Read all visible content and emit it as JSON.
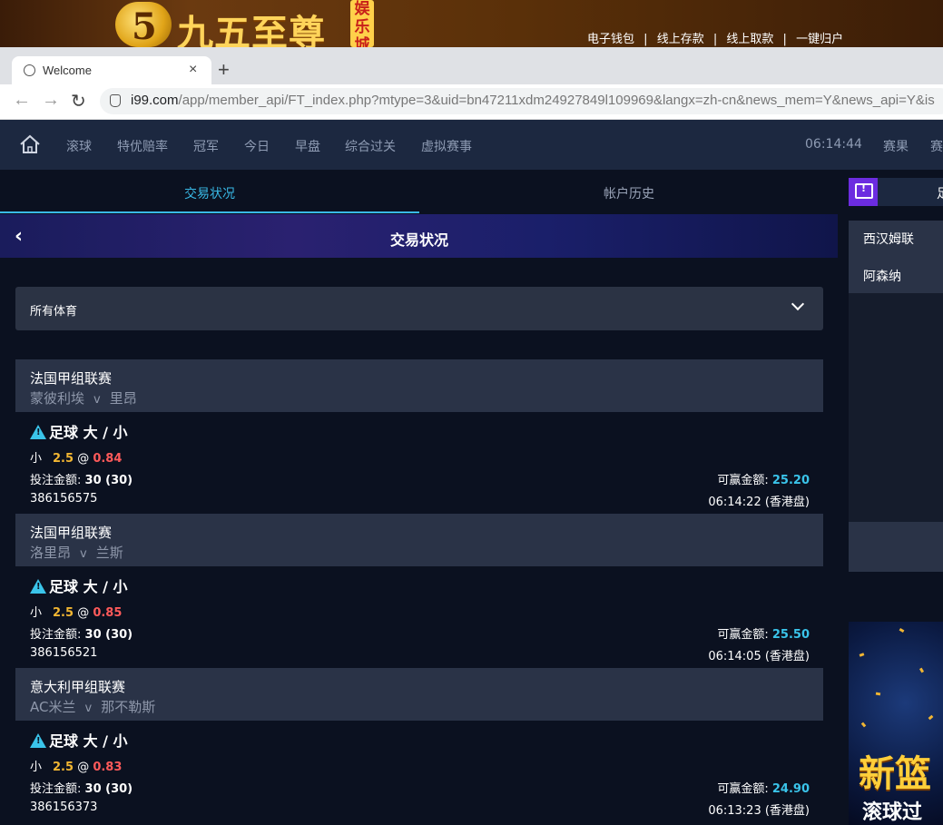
{
  "banner": {
    "logo_number": "5",
    "logo_text": "九五至尊",
    "logo_sub": "娱乐城",
    "links": [
      "电子钱包",
      "线上存款",
      "线上取款",
      "一键归户"
    ],
    "separator": "|"
  },
  "browser": {
    "tab_title": "Welcome",
    "tab_close": "×",
    "new_tab": "+",
    "back": "←",
    "forward": "→",
    "reload": "↻",
    "url_domain": "i99.com",
    "url_path": "/app/member_api/FT_index.php?mtype=3&uid=bn47211xdm24927849l109969&langx=zh-cn&news_mem=Y&news_api=Y&is"
  },
  "topnav": {
    "items": [
      "滚球",
      "特优赔率",
      "冠军",
      "今日",
      "早盘",
      "综合过关",
      "虚拟赛事"
    ],
    "clock": "06:14:44",
    "right_items": [
      "赛果",
      "赛"
    ]
  },
  "subtabs": {
    "active": "交易状况",
    "inactive": "帐户历史"
  },
  "header": {
    "back_icon": "‹",
    "title": "交易状况"
  },
  "filter": {
    "selected": "所有体育"
  },
  "bets": [
    {
      "league": "法国甲组联赛",
      "home": "蒙彼利埃",
      "vs": "v",
      "away": "里昂",
      "bet_type": "足球 大 / 小",
      "selection": "小",
      "line": "2.5",
      "at": "@",
      "odds": "0.84",
      "stake_label": "投注金额:",
      "stake": "30 (30)",
      "win_label": "可赢金额:",
      "win": "25.20",
      "ticket": "386156575",
      "time": "06:14:22 (香港盘)"
    },
    {
      "league": "法国甲组联赛",
      "home": "洛里昂",
      "vs": "v",
      "away": "兰斯",
      "bet_type": "足球 大 / 小",
      "selection": "小",
      "line": "2.5",
      "at": "@",
      "odds": "0.85",
      "stake_label": "投注金额:",
      "stake": "30 (30)",
      "win_label": "可赢金额:",
      "win": "25.50",
      "ticket": "386156521",
      "time": "06:14:05 (香港盘)"
    },
    {
      "league": "意大利甲组联赛",
      "home": "AC米兰",
      "vs": "v",
      "away": "那不勒斯",
      "bet_type": "足球 大 / 小",
      "selection": "小",
      "line": "2.5",
      "at": "@",
      "odds": "0.83",
      "stake_label": "投注金额:",
      "stake": "30 (30)",
      "win_label": "可赢金额:",
      "win": "24.90",
      "ticket": "386156373",
      "time": "06:13:23 (香港盘)"
    }
  ],
  "right_panel": {
    "tab_text": "足",
    "items": [
      "西汉姆联",
      "阿森纳"
    ],
    "promo_title": "新篮",
    "promo_sub": "滚球过"
  },
  "colors": {
    "accent_cyan": "#3ac4ea",
    "gold": "#f2b632",
    "red": "#ff5a5a",
    "purple": "#6c2ce0"
  }
}
